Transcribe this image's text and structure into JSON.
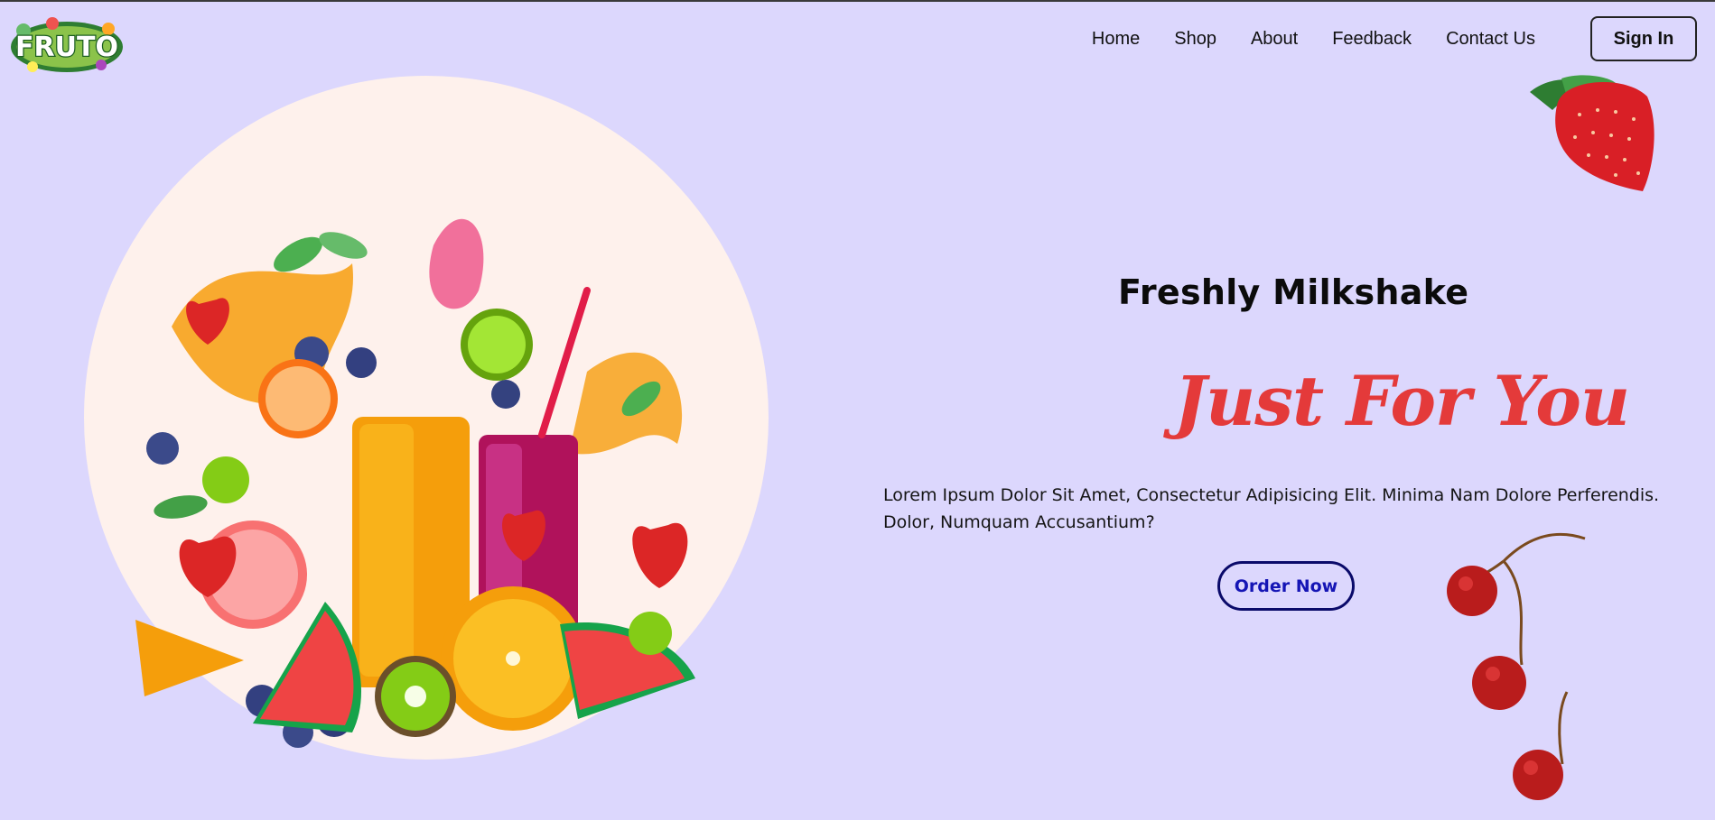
{
  "header": {
    "logo_text": "FRUTO",
    "nav": [
      {
        "label": "Home"
      },
      {
        "label": "Shop"
      },
      {
        "label": "About"
      },
      {
        "label": "Feedback"
      },
      {
        "label": "Contact Us"
      }
    ],
    "signin_label": "Sign In"
  },
  "hero": {
    "subtitle": "Freshly Milkshake",
    "headline": "Just For You",
    "description": "Lorem Ipsum Dolor Sit Amet, Consectetur Adipisicing Elit. Minima Nam Dolore Perferendis. Dolor, Numquam Accusantium?",
    "cta_label": "Order Now"
  },
  "colors": {
    "page_bg": "#dcd7fd",
    "circle_bg": "#fef1ec",
    "headline": "#e43a3a",
    "cta_text": "#1515b5",
    "cta_border": "#0a0a6a"
  }
}
